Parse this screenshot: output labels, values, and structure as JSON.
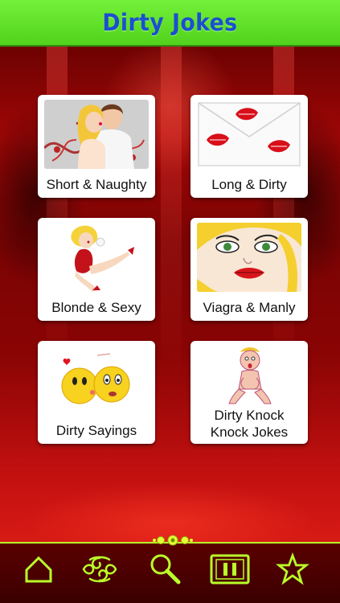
{
  "header": {
    "title": "Dirty Jokes"
  },
  "categories": [
    {
      "label": "Short & Naughty",
      "art": "kissing-couple-art"
    },
    {
      "label": "Long & Dirty",
      "art": "lipstick-envelope-art"
    },
    {
      "label": "Blonde & Sexy",
      "art": "blonde-pinup-art"
    },
    {
      "label": "Viagra & Manly",
      "art": "popart-blonde-face-art"
    },
    {
      "label": "Dirty Sayings",
      "art": "emoji-couple-art"
    },
    {
      "label": "Dirty Knock Knock Jokes",
      "label_line1": "Dirty Knock",
      "label_line2": "Knock Jokes",
      "art": "cartoon-man-art"
    }
  ],
  "tabbar": {
    "items": [
      {
        "icon": "home-icon"
      },
      {
        "icon": "tribal-swirl-icon"
      },
      {
        "icon": "search-icon"
      },
      {
        "icon": "pause-icon"
      },
      {
        "icon": "star-icon"
      }
    ]
  },
  "colors": {
    "header_bg": "#5ad824",
    "header_text": "#1b4fd0",
    "background": "#8a0404",
    "tile_bg": "#ffffff",
    "icon_neon": "#b9ff2a"
  }
}
